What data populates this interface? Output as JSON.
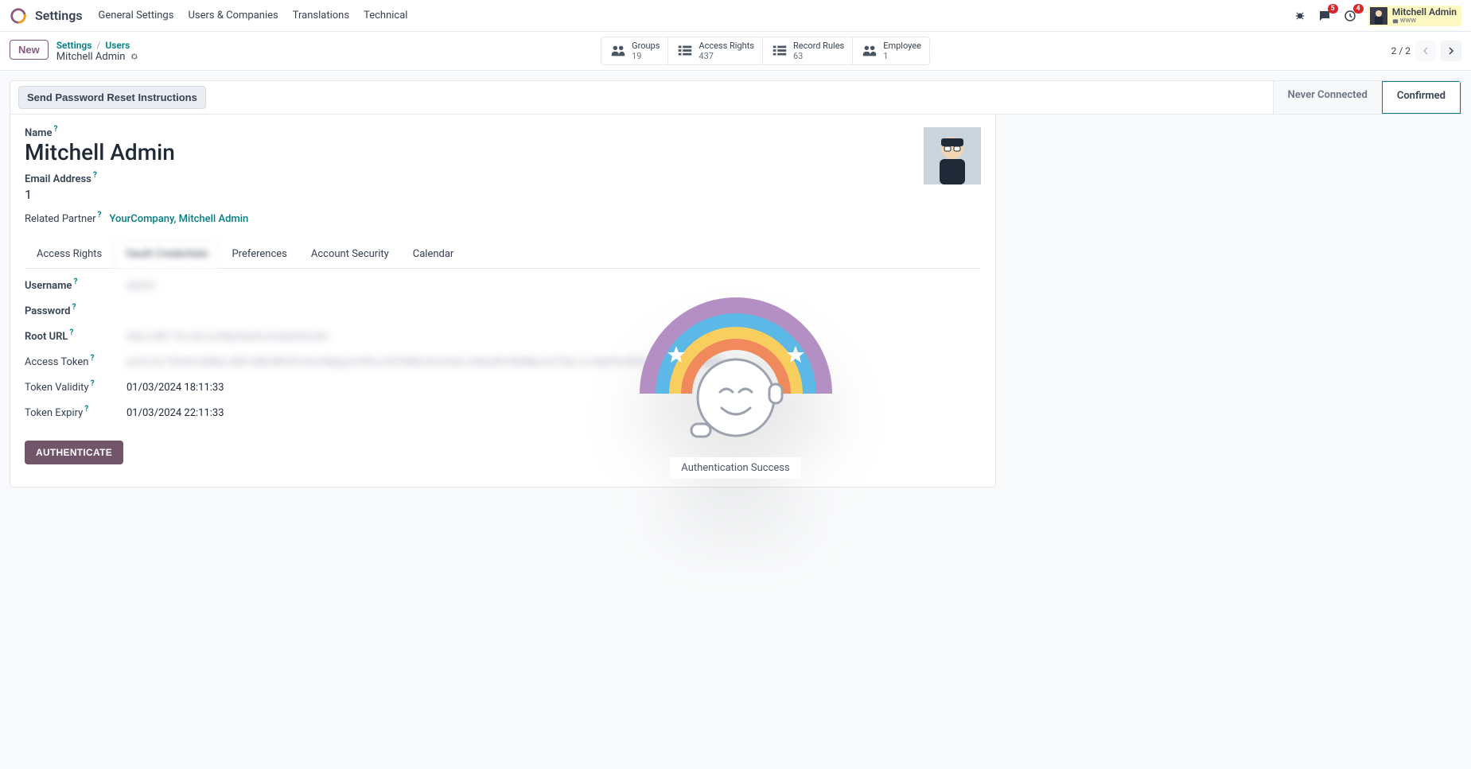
{
  "nav": {
    "app_title": "Settings",
    "items": [
      "General Settings",
      "Users & Companies",
      "Translations",
      "Technical"
    ],
    "chat_badge": "5",
    "clock_badge": "4",
    "user_name": "Mitchell Admin",
    "user_sub": "www"
  },
  "cp": {
    "new_label": "New",
    "crumb_root": "Settings",
    "crumb_parent": "Users",
    "crumb_current": "Mitchell Admin",
    "stats": [
      {
        "label": "Groups",
        "value": "19"
      },
      {
        "label": "Access Rights",
        "value": "437"
      },
      {
        "label": "Record Rules",
        "value": "63"
      },
      {
        "label": "Employee",
        "value": "1"
      }
    ],
    "pager": "2 / 2"
  },
  "statusbar": {
    "reset_btn": "Send Password Reset Instructions",
    "steps": [
      "Never Connected",
      "Confirmed"
    ]
  },
  "form": {
    "name_label": "Name",
    "name_value": "Mitchell Admin",
    "email_label": "Email Address",
    "email_value": "1",
    "partner_label": "Related Partner",
    "partner_value": "YourCompany, Mitchell Admin",
    "tabs": [
      "Access Rights",
      "Oauth Credentials",
      "Preferences",
      "Account Security",
      "Calendar"
    ],
    "fields": {
      "username_label": "Username",
      "username_value": "admin",
      "password_label": "Password",
      "rooturl_label": "Root URL",
      "rooturl_value": "http://db1.0x.net:config/backo/authenticate",
      "token_label": "Access Token",
      "token_value": "eyJh.Gc1OlUzHJkMzLnB5.GMLWKVD.lSouWgtgJLViflux.ElZ5kMlJ2nlJhanJwlIpsNt.M3MlpJxZTljinJ.6JkpHAJQl5z.........xthdCI6MT.....................................",
      "validity_label": "Token Validity",
      "validity_value": "01/03/2024 18:11:33",
      "expiry_label": "Token Expiry",
      "expiry_value": "01/03/2024 22:11:33",
      "auth_btn": "AUTHENTICATE"
    }
  },
  "overlay": {
    "caption": "Authentication Success"
  }
}
